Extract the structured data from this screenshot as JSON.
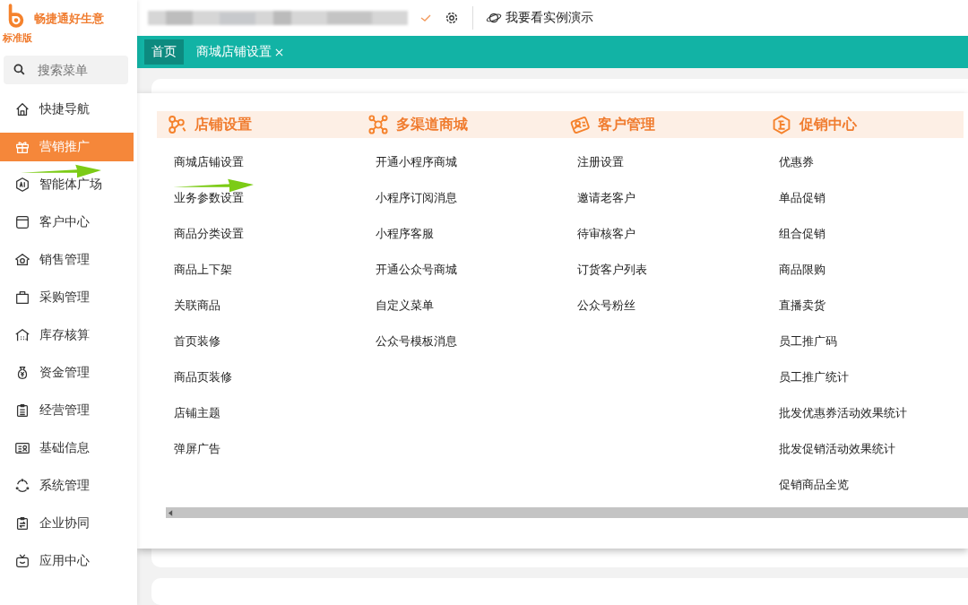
{
  "logo": {
    "name": "畅捷通好生意",
    "edition": "标准版"
  },
  "topbar": {
    "demo_link": "我要看实例演示"
  },
  "search": {
    "placeholder": "搜索菜单"
  },
  "sidebar": {
    "items": [
      {
        "label": "快捷导航",
        "selected": false
      },
      {
        "label": "营销推广",
        "selected": true
      },
      {
        "label": "智能体广场",
        "selected": false
      },
      {
        "label": "客户中心",
        "selected": false
      },
      {
        "label": "销售管理",
        "selected": false
      },
      {
        "label": "采购管理",
        "selected": false
      },
      {
        "label": "库存核算",
        "selected": false
      },
      {
        "label": "资金管理",
        "selected": false
      },
      {
        "label": "经营管理",
        "selected": false
      },
      {
        "label": "基础信息",
        "selected": false
      },
      {
        "label": "系统管理",
        "selected": false
      },
      {
        "label": "企业协同",
        "selected": false
      },
      {
        "label": "应用中心",
        "selected": false
      }
    ]
  },
  "tabs": [
    {
      "label": "首页",
      "selected": true,
      "closable": false
    },
    {
      "label": "商城店铺设置",
      "selected": false,
      "closable": true
    }
  ],
  "menu_panel": {
    "columns": [
      {
        "title": "店铺设置",
        "items": [
          "商城店铺设置",
          "业务参数设置",
          "商品分类设置",
          "商品上下架",
          "关联商品",
          "首页装修",
          "商品页装修",
          "店铺主题",
          "弹屏广告"
        ]
      },
      {
        "title": "多渠道商城",
        "items": [
          "开通小程序商城",
          "小程序订阅消息",
          "小程序客服",
          "开通公众号商城",
          "自定义菜单",
          "公众号模板消息"
        ]
      },
      {
        "title": "客户管理",
        "items": [
          "注册设置",
          "邀请老客户",
          "待审核客户",
          "订货客户列表",
          "公众号粉丝"
        ]
      },
      {
        "title": "促销中心",
        "items": [
          "优惠券",
          "单品促销",
          "组合促销",
          "商品限购",
          "直播卖货",
          "员工推广码",
          "员工推广统计",
          "批发优惠券活动效果统计",
          "批发促销活动效果统计",
          "促销商品全览"
        ]
      }
    ]
  }
}
